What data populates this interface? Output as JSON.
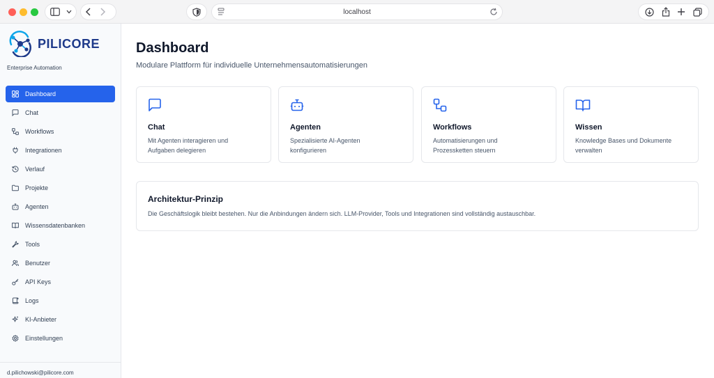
{
  "browser": {
    "url": "localhost"
  },
  "colors": {
    "accent": "#2563eb",
    "logo_blue": "#1e3a8a",
    "logo_teal": "#0ea5e9"
  },
  "sidebar": {
    "logo_text": "PILICORE",
    "tagline": "Enterprise Automation",
    "items": [
      {
        "label": "Dashboard",
        "icon": "layout-grid-icon",
        "active": true
      },
      {
        "label": "Chat",
        "icon": "message-square-icon"
      },
      {
        "label": "Workflows",
        "icon": "workflow-icon"
      },
      {
        "label": "Integrationen",
        "icon": "plug-icon"
      },
      {
        "label": "Verlauf",
        "icon": "history-icon"
      },
      {
        "label": "Projekte",
        "icon": "folder-icon"
      },
      {
        "label": "Agenten",
        "icon": "bot-icon"
      },
      {
        "label": "Wissensdatenbanken",
        "icon": "book-open-icon"
      },
      {
        "label": "Tools",
        "icon": "wrench-icon"
      },
      {
        "label": "Benutzer",
        "icon": "users-icon"
      },
      {
        "label": "API Keys",
        "icon": "key-icon"
      },
      {
        "label": "Logs",
        "icon": "scroll-icon"
      },
      {
        "label": "KI-Anbieter",
        "icon": "sparkles-icon"
      },
      {
        "label": "Einstellungen",
        "icon": "settings-icon"
      }
    ],
    "user_email": "d.pilichowski@pilicore.com"
  },
  "main": {
    "title": "Dashboard",
    "subtitle": "Modulare Plattform für individuelle Unternehmensautomatisierungen",
    "cards": [
      {
        "title": "Chat",
        "desc_line1": "Mit Agenten interagieren und",
        "desc_line2": "Aufgaben delegieren",
        "icon": "message-square-icon"
      },
      {
        "title": "Agenten",
        "desc_line1": "Spezialisierte AI-Agenten",
        "desc_line2": "konfigurieren",
        "icon": "bot-icon"
      },
      {
        "title": "Workflows",
        "desc_line1": "Automatisierungen und",
        "desc_line2": "Prozessketten steuern",
        "icon": "workflow-icon"
      },
      {
        "title": "Wissen",
        "desc_line1": "Knowledge Bases und Dokumente",
        "desc_line2": "verwalten",
        "icon": "book-open-icon"
      }
    ],
    "principle": {
      "title": "Architektur-Prinzip",
      "text": "Die Geschäftslogik bleibt bestehen. Nur die Anbindungen ändern sich. LLM-Provider, Tools und Integrationen sind vollständig austauschbar."
    }
  }
}
